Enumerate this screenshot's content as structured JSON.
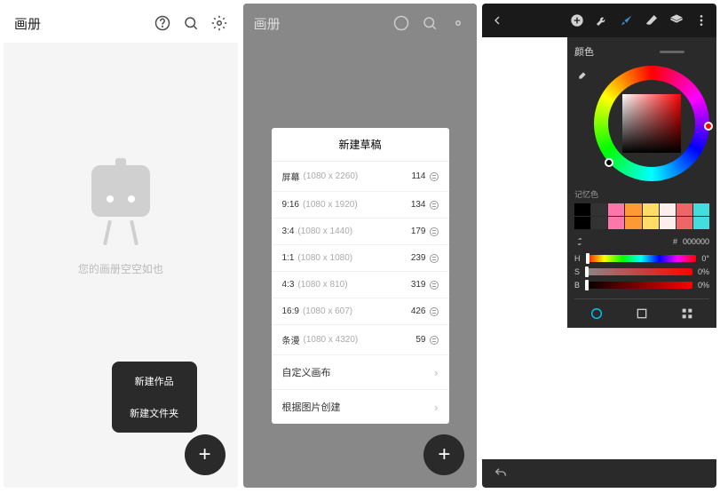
{
  "screen1": {
    "title": "画册",
    "empty_text": "您的画册空空如也",
    "menu": {
      "new_work": "新建作品",
      "new_folder": "新建文件夹"
    }
  },
  "screen2": {
    "title": "画册",
    "dialog": {
      "title": "新建草稿",
      "presets": [
        {
          "label": "屏幕",
          "dim": "(1080 x 2260)",
          "count": "114"
        },
        {
          "label": "9:16",
          "dim": "(1080 x 1920)",
          "count": "134"
        },
        {
          "label": "3:4",
          "dim": "(1080 x 1440)",
          "count": "179"
        },
        {
          "label": "1:1",
          "dim": "(1080 x 1080)",
          "count": "239"
        },
        {
          "label": "4:3",
          "dim": "(1080 x 810)",
          "count": "319"
        },
        {
          "label": "16:9",
          "dim": "(1080 x 607)",
          "count": "426"
        },
        {
          "label": "条漫",
          "dim": "(1080 x 4320)",
          "count": "59"
        }
      ],
      "custom": "自定义画布",
      "from_image": "根据图片创建"
    }
  },
  "screen3": {
    "panel_title": "颜色",
    "memory_label": "记忆色",
    "swatches": [
      "#000",
      "#333",
      "#f7a",
      "#f93",
      "#fd6",
      "#fee",
      "#e66",
      "#4dd",
      "#000",
      "#333",
      "#f7a",
      "#f93",
      "#fd6",
      "#fee",
      "#e66",
      "#4dd"
    ],
    "hex_prefix": "#",
    "hex_value": "000000",
    "sliders": {
      "h": "H",
      "s": "S",
      "b": "B",
      "h_val": "0°",
      "s_val": "0%",
      "b_val": "0%"
    }
  }
}
